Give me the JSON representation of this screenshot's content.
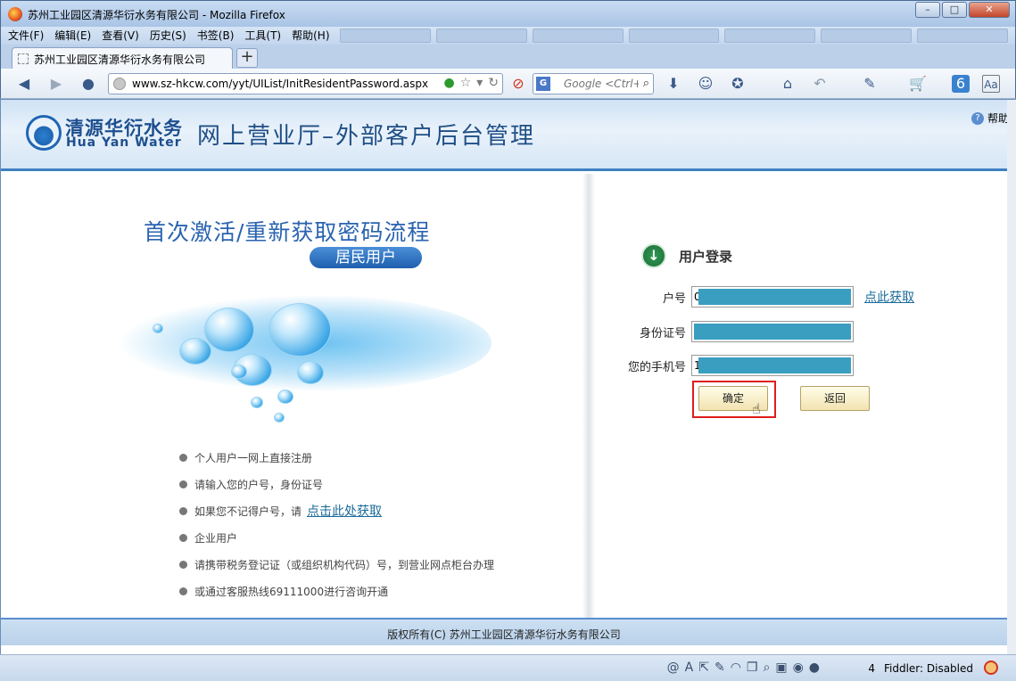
{
  "window": {
    "title": "苏州工业园区清源华衍水务有限公司 - Mozilla Firefox",
    "minimize": "–",
    "maximize": "□",
    "close": "✕"
  },
  "menubar": {
    "items": [
      "文件(F)",
      "编辑(E)",
      "查看(V)",
      "历史(S)",
      "书签(B)",
      "工具(T)",
      "帮助(H)"
    ]
  },
  "tabs": [
    {
      "label": "苏州工业园区清源华衍水务有限公司"
    }
  ],
  "newtab_label": "+",
  "navbar": {
    "url": "www.sz-hkcw.com/yyt/UIList/InitResidentPassword.aspx",
    "search_placeholder": "Google <Ctrl+K>",
    "search_engine": "G"
  },
  "header": {
    "logo_cn": "清源华衍水务",
    "logo_en": "Hua Yan Water",
    "site_title": "网上营业厅–外部客户后台管理",
    "help": "帮助",
    "help_icon": "?"
  },
  "left": {
    "flow_title": "首次激活/重新获取密码流程",
    "badge": "居民用户",
    "info": [
      {
        "text": "个人用户一网上直接注册"
      },
      {
        "text": "请输入您的户号，身份证号"
      },
      {
        "text": "如果您不记得户号，请",
        "link": "点击此处获取"
      },
      {
        "text": "企业用户"
      },
      {
        "text": "请携带税务登记证（或组织机构代码）号，到营业网点柜台办理"
      },
      {
        "text": "或通过客服热线69111000进行咨询开通"
      }
    ]
  },
  "login": {
    "title": "用户登录",
    "account_label": "户号",
    "account_value": "0",
    "account_link": "点此获取",
    "id_label": "身份证号",
    "id_value": "",
    "phone_label": "您的手机号",
    "phone_value": "1",
    "confirm": "确定",
    "back": "返回"
  },
  "footer": {
    "copyright": "版权所有(C) 苏州工业园区清源华衍水务有限公司"
  },
  "statusbar": {
    "count": "4",
    "fiddler": "Fiddler: Disabled"
  },
  "colors": {
    "accent": "#3e7fc1",
    "highlight": "#e01c1c",
    "mask": "#3a9ec0",
    "link": "#1a6a9a"
  }
}
